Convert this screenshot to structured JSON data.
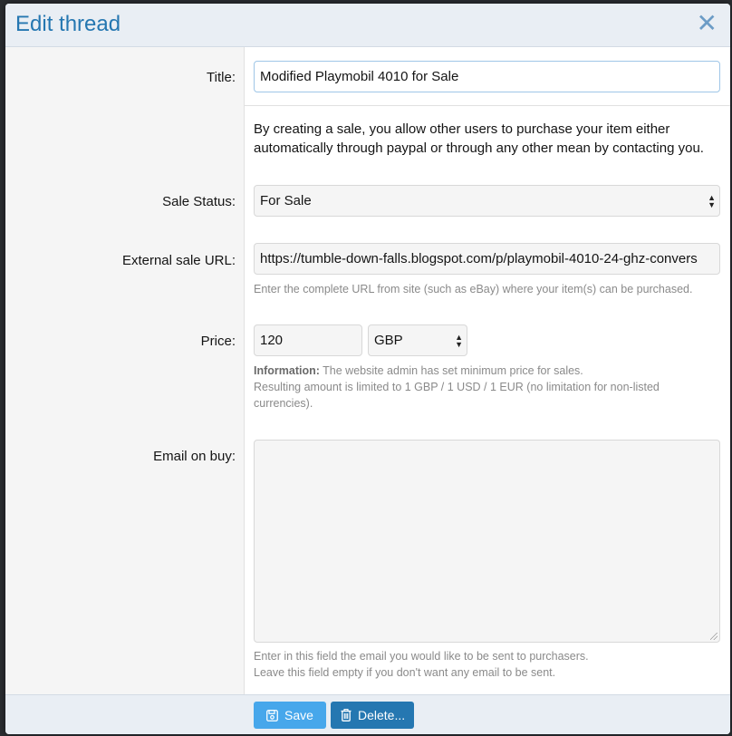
{
  "dialog": {
    "title": "Edit thread",
    "close_symbol": "✕"
  },
  "fields": {
    "title": {
      "label": "Title:",
      "value": "Modified Playmobil 4010 for Sale"
    },
    "description": "By creating a sale, you allow other users to purchase your item either automatically through paypal or through any other mean by contacting you.",
    "sale_status": {
      "label": "Sale Status:",
      "value": "For Sale"
    },
    "external_url": {
      "label": "External sale URL:",
      "value": "https://tumble-down-falls.blogspot.com/p/playmobil-4010-24-ghz-convers",
      "hint": "Enter the complete URL from site (such as eBay) where your item(s) can be purchased."
    },
    "price": {
      "label": "Price:",
      "value": "120",
      "currency": "GBP",
      "info_bold": "Information:",
      "info_text": " The website admin has set minimum price for sales.",
      "limit_line1": "Resulting amount is limited to 1 GBP / 1 USD / 1 EUR (no limitation for non-listed",
      "limit_line2": "currencies)."
    },
    "email_on_buy": {
      "label": "Email on buy:",
      "value": "",
      "hint1": "Enter in this field the email you would like to be sent to purchasers.",
      "hint2": "Leave this field empty if you don't want any email to be sent."
    }
  },
  "footer": {
    "save_label": "Save",
    "delete_label": "Delete..."
  },
  "icons": {
    "close": "close-icon",
    "save": "save-icon",
    "delete": "trash-icon",
    "select": "select-arrows-icon"
  },
  "colors": {
    "accent": "#2577b1",
    "save_button": "#47a7eb",
    "header_bg": "#e9eef4"
  }
}
